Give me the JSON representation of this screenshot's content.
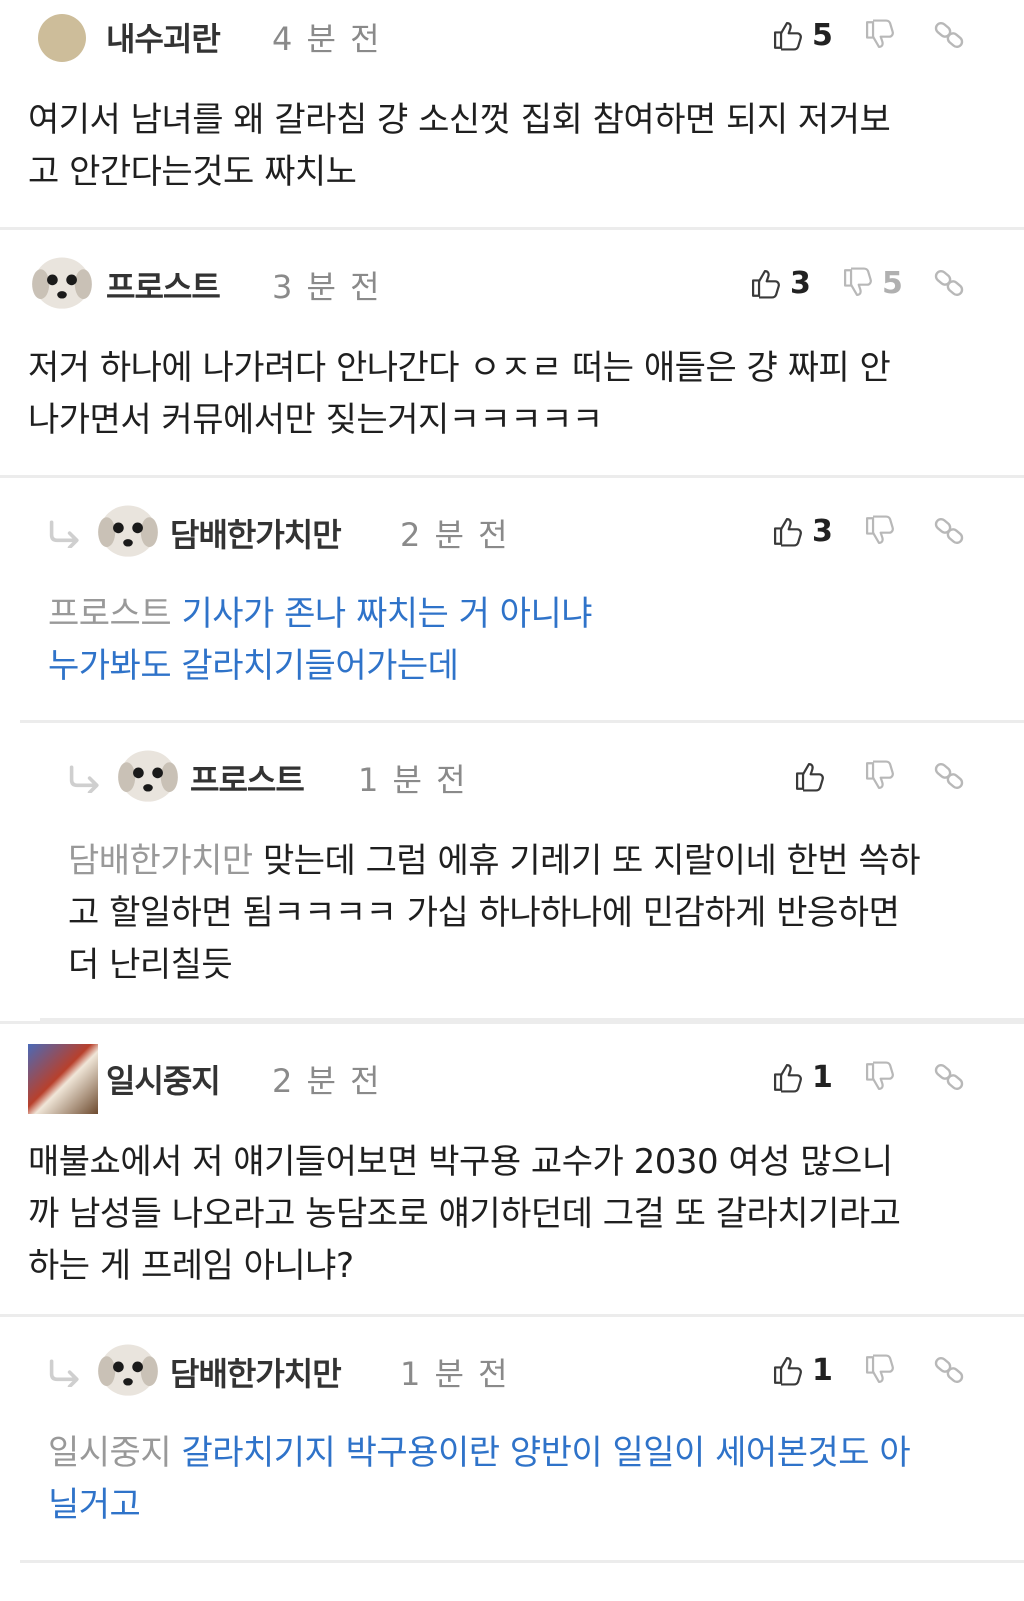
{
  "comments": [
    {
      "nickname": "내수괴란",
      "time": "4 분 전",
      "likes": "5",
      "dislikes": "",
      "text": "여기서 남녀를 왜 갈라침 걍 소신껏 집회 참여하면 되지 저거보고 안간다는것도 짜치노",
      "text_line1": "여기서 남녀를 왜 갈라침 걍 소신껏 집회 참여하면 되지 저거보",
      "text_line2": "고 안간다는것도 짜치노"
    },
    {
      "nickname": "프로스트",
      "time": "3 분 전",
      "likes": "3",
      "dislikes": "5",
      "text_line1": "저거 하나에 나가려다 안나간다 ㅇㅈㄹ 떠는 애들은 걍 짜피 안",
      "text_line2": "나가면서 커뮤에서만 짖는거지ㅋㅋㅋㅋㅋ"
    },
    {
      "nickname": "담배한가치만",
      "time": "2 분 전",
      "likes": "3",
      "dislikes": "",
      "mention": "프로스트",
      "text_line1": "기사가 존나 짜치는 거 아니냐",
      "text_line2": "누가봐도 갈라치기들어가는데"
    },
    {
      "nickname": "프로스트",
      "time": "1 분 전",
      "likes": "",
      "dislikes": "",
      "mention": "담배한가치만",
      "text_line1": "맞는데 그럼 에휴 기레기 또 지랄이네 한번 쓱하",
      "text_line2": "고 할일하면 됨ㅋㅋㅋㅋ 가십 하나하나에 민감하게 반응하면",
      "text_line3": "더 난리칠듯"
    },
    {
      "nickname": "일시중지",
      "time": "2 분 전",
      "likes": "1",
      "dislikes": "",
      "text_line1": "매불쇼에서 저 얘기들어보면 박구용 교수가 2030 여성 많으니",
      "text_line2": "까 남성들 나오라고 농담조로 얘기하던데 그걸 또 갈라치기라고",
      "text_line3": "하는 게 프레임 아니냐?"
    },
    {
      "nickname": "담배한가치만",
      "time": "1 분 전",
      "likes": "1",
      "dislikes": "",
      "mention": "일시중지",
      "text_line1": "갈라치기지 박구용이란 양반이 일일이 세어본것도 아",
      "text_line2": "닐거고"
    }
  ],
  "icons": {
    "like": "thumbs-up-icon",
    "dislike": "thumbs-down-icon",
    "link": "link-icon",
    "reply": "reply-arrow-icon"
  },
  "colors": {
    "reply_text": "#2f73c9",
    "mention": "#999999",
    "muted": "#b0b0b0"
  }
}
